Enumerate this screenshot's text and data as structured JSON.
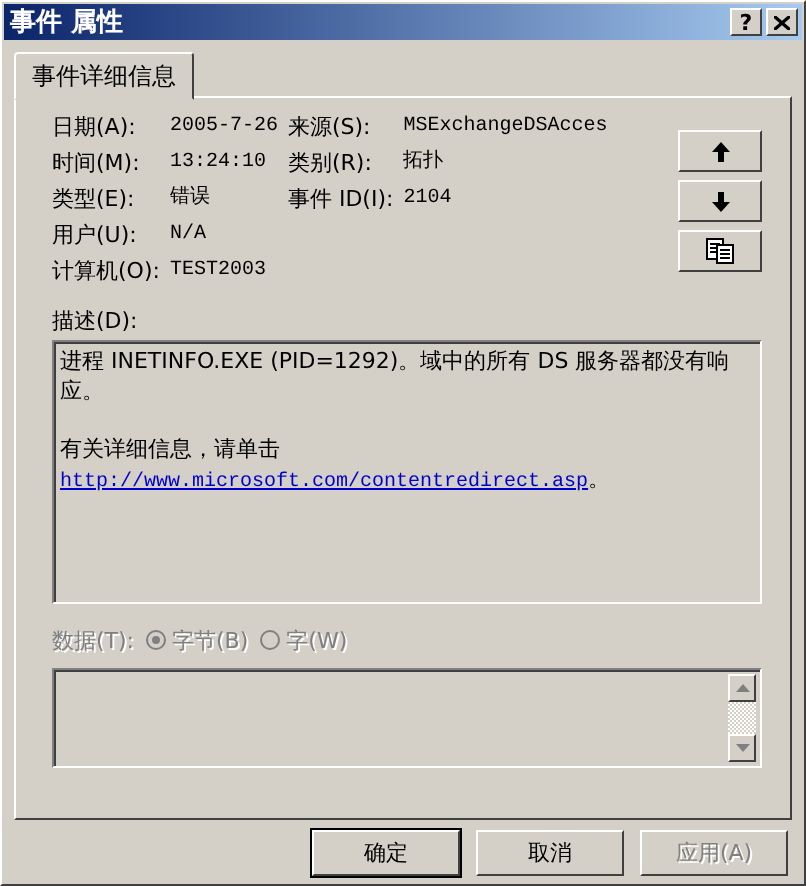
{
  "window": {
    "title": "事件 属性",
    "help": "?",
    "close": true
  },
  "tabs": [
    {
      "label": "事件详细信息",
      "selected": true
    }
  ],
  "fields": [
    {
      "label": "日期(A):",
      "value": "2005-7-26",
      "label_2": "来源(S):",
      "value_2": "MSExchangeDSAcces"
    },
    {
      "label": "时间(M):",
      "value": "13:24:10",
      "label_2": "类别(R):",
      "value_2": "拓扑"
    },
    {
      "label": "类型(E):",
      "value": "错误",
      "label_2": "事件 ID(I):",
      "value_2": "2104"
    },
    {
      "label": "用户(U):",
      "value": "N/A"
    },
    {
      "label": "计算机(O):",
      "value": "TEST2003"
    }
  ],
  "nav_buttons": [
    {
      "kind": "up"
    },
    {
      "kind": "down"
    },
    {
      "kind": "copy"
    }
  ],
  "description": {
    "label": "描述(D):",
    "text": "进程 INETINFO.EXE (PID=1292)。域中的所有 DS 服务器都没有响应。",
    "more": "有关详细信息，请单击",
    "link": "http://www.microsoft.com/contentredirect.asp",
    "link_suffix": "。"
  },
  "data": {
    "label": "数据(T):",
    "disabled": true,
    "options": [
      {
        "label": "字节(B)",
        "selected": true
      },
      {
        "label": "字(W)",
        "selected": false
      }
    ]
  },
  "buttons": [
    {
      "label": "确定",
      "default": true,
      "disabled": false
    },
    {
      "label": "取消",
      "default": false,
      "disabled": false
    },
    {
      "label": "应用(A)",
      "default": false,
      "disabled": true
    }
  ]
}
